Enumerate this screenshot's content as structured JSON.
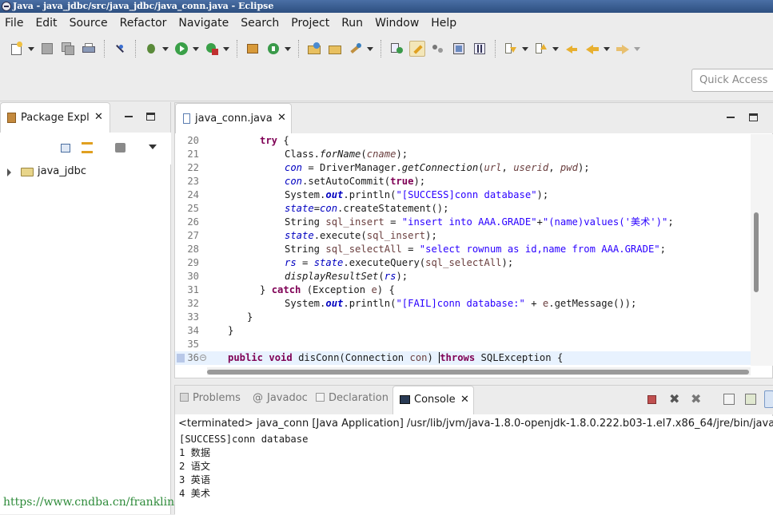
{
  "window": {
    "title": "Java - java_jdbc/src/java_jdbc/java_conn.java - Eclipse"
  },
  "menu": [
    "File",
    "Edit",
    "Source",
    "Refactor",
    "Navigate",
    "Search",
    "Project",
    "Run",
    "Window",
    "Help"
  ],
  "quick_access": {
    "placeholder": "Quick Access"
  },
  "package_explorer": {
    "tab_label": "Package Expl",
    "close": "✕",
    "items": [
      {
        "label": "java_jdbc"
      }
    ]
  },
  "editor": {
    "tab_label": "java_conn.java",
    "close": "✕",
    "current_line": 36,
    "lines": [
      {
        "n": "20"
      },
      {
        "n": "21"
      },
      {
        "n": "22"
      },
      {
        "n": "23"
      },
      {
        "n": "24"
      },
      {
        "n": "25"
      },
      {
        "n": "26"
      },
      {
        "n": "27"
      },
      {
        "n": "28"
      },
      {
        "n": "29"
      },
      {
        "n": "30"
      },
      {
        "n": "31"
      },
      {
        "n": "32"
      },
      {
        "n": "33"
      },
      {
        "n": "34"
      },
      {
        "n": "35"
      },
      {
        "n": "36"
      }
    ],
    "code": {
      "l20_kw": "try",
      "l20_rest": " {",
      "l21_a": "Class.",
      "l21_b": "forName",
      "l21_c": "(",
      "l21_d": "cname",
      "l21_e": ");",
      "l22_a": "con",
      "l22_b": " = DriverManager.",
      "l22_c": "getConnection",
      "l22_d": "(",
      "l22_e": "url",
      "l22_f": ", ",
      "l22_g": "userid",
      "l22_h": ", ",
      "l22_i": "pwd",
      "l22_j": ");",
      "l23_a": "con",
      "l23_b": ".setAutoCommit(",
      "l23_c": "true",
      "l23_d": ");",
      "l24_a": "System.",
      "l24_b": "out",
      "l24_c": ".println(",
      "l24_d": "\"[SUCCESS]conn database\"",
      "l24_e": ");",
      "l25_a": "state",
      "l25_b": "=",
      "l25_c": "con",
      "l25_d": ".createStatement();",
      "l26_a": "String ",
      "l26_b": "sql_insert",
      "l26_c": " = ",
      "l26_d": "\"insert into AAA.GRADE\"",
      "l26_e": "+",
      "l26_f": "\"(name)values('美术')\"",
      "l26_g": ";",
      "l27_a": "state",
      "l27_b": ".execute(",
      "l27_c": "sql_insert",
      "l27_d": ");",
      "l28_a": "String ",
      "l28_b": "sql_selectAll",
      "l28_c": " = ",
      "l28_d": "\"select rownum as id,name from AAA.GRADE\"",
      "l28_e": ";",
      "l29_a": "rs",
      "l29_b": " = ",
      "l29_c": "state",
      "l29_d": ".executeQuery(",
      "l29_e": "sql_selectAll",
      "l29_f": ");",
      "l30_a": "displayResultSet",
      "l30_b": "(",
      "l30_c": "rs",
      "l30_d": ");",
      "l31_a": "} ",
      "l31_b": "catch",
      "l31_c": " (Exception ",
      "l31_d": "e",
      "l31_e": ") {",
      "l32_a": "System.",
      "l32_b": "out",
      "l32_c": ".println(",
      "l32_d": "\"[FAIL]conn database:\"",
      "l32_e": " + ",
      "l32_f": "e",
      "l32_g": ".getMessage());",
      "l33": "}",
      "l34": "}",
      "l36_a": "public",
      "l36_b": " ",
      "l36_c": "void",
      "l36_d": " disConn(Connection ",
      "l36_e": "con",
      "l36_f": ") ",
      "l36_g": "throws",
      "l36_h": " SQLException {"
    }
  },
  "bottom_tabs": [
    {
      "label": "Problems"
    },
    {
      "label": "Javadoc"
    },
    {
      "label": "Declaration"
    },
    {
      "label": "Console"
    }
  ],
  "console": {
    "terminated": "<terminated> java_conn [Java Application] /usr/lib/jvm/java-1.8.0-openjdk-1.8.0.222.b03-1.el7.x86_64/jre/bin/java",
    "output": [
      "[SUCCESS]conn database",
      "1 数据",
      "2 语文",
      "3 英语",
      "4 美术"
    ]
  },
  "watermark": "https://www.cndba.cn/franklin"
}
